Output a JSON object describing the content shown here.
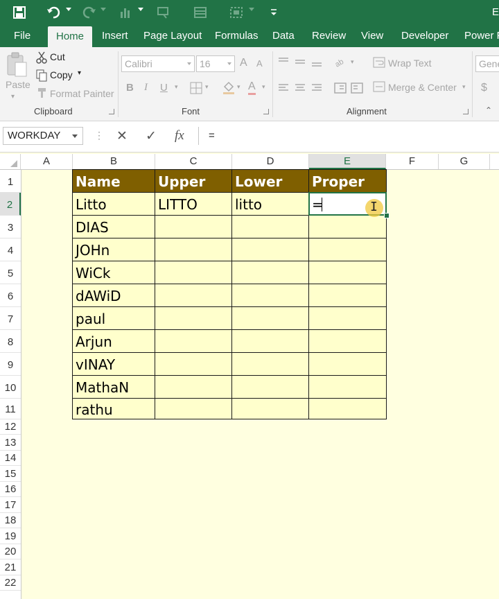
{
  "qat": {
    "icons": [
      "save-icon",
      "undo-icon",
      "redo-icon",
      "chart-icon",
      "shape-icon",
      "form-icon",
      "camera-icon",
      "customize-icon"
    ],
    "title_fragment": "E"
  },
  "tabs": [
    "File",
    "Home",
    "Insert",
    "Page Layout",
    "Formulas",
    "Data",
    "Review",
    "View",
    "Developer",
    "Power Pi"
  ],
  "active_tab": "Home",
  "ribbon": {
    "clipboard": {
      "paste": "Paste",
      "cut": "Cut",
      "copy": "Copy",
      "format_painter": "Format Painter",
      "label": "Clipboard"
    },
    "font": {
      "name": "Calibri",
      "size": "16",
      "bold": "B",
      "italic": "I",
      "underline": "U",
      "grow": "A",
      "shrink": "A",
      "font_color": "A",
      "label": "Font"
    },
    "alignment": {
      "wrap_text": "Wrap Text",
      "merge_center": "Merge & Center",
      "label": "Alignment"
    },
    "number": {
      "format": "Gene",
      "currency": "$"
    }
  },
  "formula_bar": {
    "name_box": "WORKDAY",
    "cancel": "✕",
    "enter": "✓",
    "fx": "fx",
    "content": "="
  },
  "grid": {
    "columns": [
      "A",
      "B",
      "C",
      "D",
      "E",
      "F",
      "G"
    ],
    "selected_column": "E",
    "rows": [
      "1",
      "2",
      "3",
      "4",
      "5",
      "6",
      "7",
      "8",
      "9",
      "10",
      "11",
      "12",
      "13",
      "14",
      "15",
      "16",
      "17",
      "18",
      "19",
      "20",
      "21",
      "22"
    ],
    "selected_row": "2",
    "headers": [
      "Name",
      "Upper",
      "Lower",
      "Proper"
    ],
    "names": [
      "Litto",
      "DIAS",
      "JOHn",
      "WiCk",
      "dAWiD",
      "paul",
      "Arjun",
      "vINAY",
      "MathaN",
      "rathu"
    ],
    "upper_first": "LITTO",
    "lower_first": "litto",
    "active_cell_text": "="
  },
  "colors": {
    "ribbon_green": "#217346",
    "header_fill": "#7f5f00",
    "body_fill": "#ffffcc",
    "sheet_bg": "#ffffe0"
  }
}
